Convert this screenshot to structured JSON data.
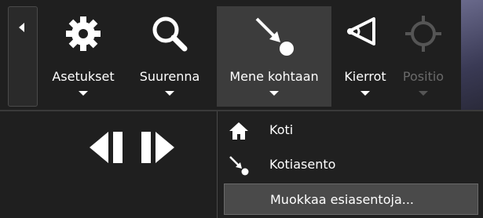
{
  "toolbar": {
    "items": [
      {
        "label": "Asetukset",
        "icon": "gear-icon"
      },
      {
        "label": "Suurenna",
        "icon": "magnifier-icon"
      },
      {
        "label": "Mene kohtaan",
        "icon": "goto-arrow-icon",
        "active": true
      },
      {
        "label": "Kierrot",
        "icon": "rotation-icon"
      },
      {
        "label": "Positio",
        "icon": "crosshair-icon",
        "disabled": true
      }
    ]
  },
  "playback": {
    "prev_icon": "step-back-icon",
    "next_icon": "step-forward-icon"
  },
  "menu": {
    "items": [
      {
        "label": "Koti",
        "icon": "home-icon"
      },
      {
        "label": "Kotiasento",
        "icon": "goto-arrow-icon"
      },
      {
        "label": "Muokkaa esiasentoja...",
        "highlighted": true
      }
    ]
  },
  "colors": {
    "background": "#1f1f1f",
    "active_bg": "#3c3c3c",
    "highlight_bg": "#4a4a4a",
    "text": "#ffffff",
    "disabled_text": "#6a6a6a"
  }
}
